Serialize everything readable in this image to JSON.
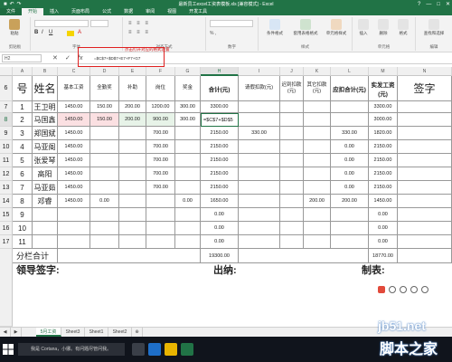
{
  "window": {
    "title": "最新员工excel工资表模板.xls [兼容模式] - Excel",
    "controls": [
      "?",
      "—",
      "□",
      "✕"
    ]
  },
  "ribbon": {
    "tabs": [
      {
        "label": "文件",
        "active": false
      },
      {
        "label": "开始",
        "active": true
      },
      {
        "label": "插入",
        "active": false
      },
      {
        "label": "页面布局",
        "active": false
      },
      {
        "label": "公式",
        "active": false
      },
      {
        "label": "数据",
        "active": false
      },
      {
        "label": "审阅",
        "active": false
      },
      {
        "label": "视图",
        "active": false
      },
      {
        "label": "开发工具",
        "active": false
      }
    ],
    "groups": [
      "剪贴板",
      "字体",
      "对齐方式",
      "数字",
      "样式",
      "单元格",
      "编辑"
    ],
    "buttons": {
      "paste": "粘贴",
      "cond_format": "条件格式",
      "table_format": "套用表格格式",
      "cell_style": "单元格样式",
      "insert": "插入",
      "delete": "删除",
      "format": "格式",
      "find": "查找和选择"
    },
    "tip": "点击打开对应的格式设置"
  },
  "formula_bar": {
    "name_box": "H2",
    "formula": "=$C$7+$D$7+E7+F7+G7"
  },
  "columns": [
    "A",
    "B",
    "C",
    "D",
    "E",
    "F",
    "G",
    "H",
    "I",
    "J",
    "K",
    "L",
    "M",
    "N"
  ],
  "rows": [
    {
      "num": "6",
      "label": "号"
    },
    {
      "num": "7",
      "label": "1"
    },
    {
      "num": "8",
      "label": "2"
    },
    {
      "num": "9",
      "label": "3"
    },
    {
      "num": "10",
      "label": "4"
    },
    {
      "num": "11",
      "label": "5"
    },
    {
      "num": "12",
      "label": "6"
    },
    {
      "num": "13",
      "label": "7"
    },
    {
      "num": "14",
      "label": "8"
    },
    {
      "num": "15",
      "label": "9"
    },
    {
      "num": "16",
      "label": "10"
    },
    {
      "num": "17",
      "label": "11"
    }
  ],
  "table": {
    "header": {
      "name": "姓名",
      "base_salary": "基本工资",
      "full_attendance": "全勤奖",
      "subsidy": "补助",
      "position": "岗位",
      "bonus": "奖金",
      "total": "合计(元)",
      "leave_deduct": "请假扣款(元)",
      "late_deduct": "迟到扣款(元)",
      "other_deduct": "其它扣款(元)",
      "should_deduct": "应扣合计(元)",
      "actual_pay": "实发工资(元)",
      "signature": "签字"
    },
    "records": [
      {
        "no": "1",
        "name": "王卫明",
        "base": "1450.00",
        "full": "150.00",
        "subsidy": "200.00",
        "position": "1200.00",
        "bonus": "300.00",
        "total": "3300.00",
        "leave": "",
        "late": "",
        "other": "",
        "should": "",
        "actual": "3300.00"
      },
      {
        "no": "2",
        "name": "马国鑫",
        "base": "1450.00",
        "full": "150.00",
        "subsidy": "200.00",
        "position": "900.00",
        "bonus": "300.00",
        "total": "=$C$7+$D$5",
        "leave": "",
        "late": "",
        "other": "",
        "should": "",
        "actual": "3000.00"
      },
      {
        "no": "3",
        "name": "郑国斌",
        "base": "1450.00",
        "full": "",
        "subsidy": "",
        "position": "700.00",
        "bonus": "",
        "total": "2150.00",
        "leave": "330.00",
        "late": "",
        "other": "",
        "should": "330.00",
        "actual": "1820.00"
      },
      {
        "no": "4",
        "name": "马亚阁",
        "base": "1450.00",
        "full": "",
        "subsidy": "",
        "position": "700.00",
        "bonus": "",
        "total": "2150.00",
        "leave": "",
        "late": "",
        "other": "",
        "should": "0.00",
        "actual": "2150.00"
      },
      {
        "no": "5",
        "name": "张爱琴",
        "base": "1450.00",
        "full": "",
        "subsidy": "",
        "position": "700.00",
        "bonus": "",
        "total": "2150.00",
        "leave": "",
        "late": "",
        "other": "",
        "should": "0.00",
        "actual": "2150.00"
      },
      {
        "no": "6",
        "name": "高阳",
        "base": "1450.00",
        "full": "",
        "subsidy": "",
        "position": "700.00",
        "bonus": "",
        "total": "2150.00",
        "leave": "",
        "late": "",
        "other": "",
        "should": "0.00",
        "actual": "2150.00"
      },
      {
        "no": "7",
        "name": "马亚茹",
        "base": "1450.00",
        "full": "",
        "subsidy": "",
        "position": "700.00",
        "bonus": "",
        "total": "2150.00",
        "leave": "",
        "late": "",
        "other": "",
        "should": "0.00",
        "actual": "2150.00"
      },
      {
        "no": "8",
        "name": "邓睿",
        "base": "1450.00",
        "full": "0.00",
        "subsidy": "",
        "position": "",
        "bonus": "0.00",
        "total": "1650.00",
        "leave": "",
        "late": "",
        "other": "200.00",
        "should": "200.00",
        "actual": "1450.00"
      },
      {
        "no": "9",
        "name": "",
        "base": "",
        "full": "",
        "subsidy": "",
        "position": "",
        "bonus": "",
        "total": "0.00",
        "leave": "",
        "late": "",
        "other": "",
        "should": "",
        "actual": "0.00"
      },
      {
        "no": "10",
        "name": "",
        "base": "",
        "full": "",
        "subsidy": "",
        "position": "",
        "bonus": "",
        "total": "0.00",
        "leave": "",
        "late": "",
        "other": "",
        "should": "",
        "actual": "0.00"
      },
      {
        "no": "11",
        "name": "",
        "base": "",
        "full": "",
        "subsidy": "",
        "position": "",
        "bonus": "",
        "total": "0.00",
        "leave": "",
        "late": "",
        "other": "",
        "should": "",
        "actual": "0.00"
      }
    ],
    "subtotal": {
      "label": "分栏合计",
      "total": "19300.00",
      "actual": "18770.00"
    }
  },
  "footer": {
    "leader": "领导签字:",
    "cashier": "出纳:",
    "maker": "制表:"
  },
  "sheets": [
    {
      "label": "5月工资",
      "active": true
    },
    {
      "label": "Sheet3",
      "active": false
    },
    {
      "label": "Sheet1",
      "active": false
    },
    {
      "label": "Sheet2",
      "active": false
    },
    {
      "label": "⊕",
      "active": false
    }
  ],
  "taskbar": {
    "cortana": "我是 Cortana，小娜。有问题尽管问我。"
  },
  "watermark": {
    "site": "jb51.net",
    "name": "脚本之家"
  },
  "colors": {
    "excel_green": "#217346",
    "highlight_pink": "#fbe0e2",
    "highlight_green": "#e7f3e8",
    "annotation_red": "#e02020"
  }
}
